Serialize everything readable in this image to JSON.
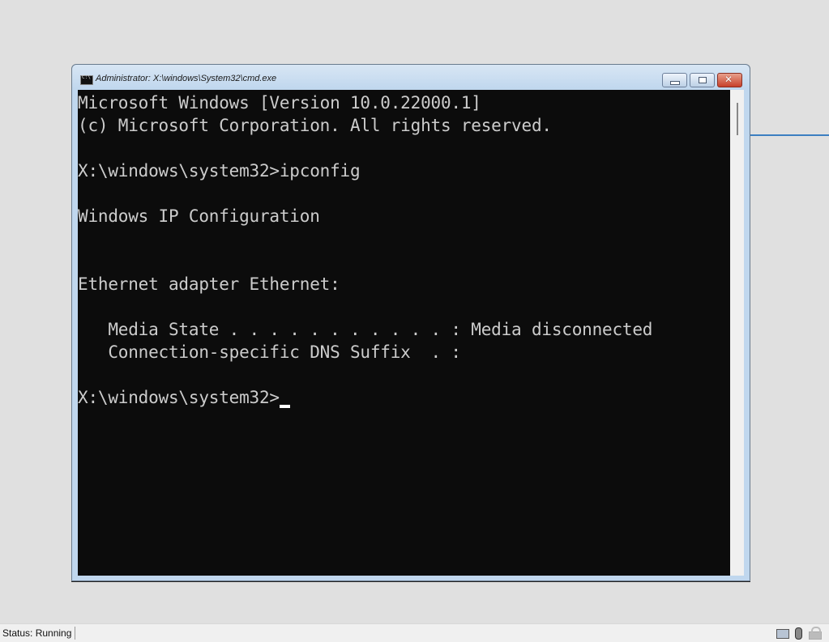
{
  "window": {
    "title": "Administrator: X:\\windows\\System32\\cmd.exe",
    "buttons": {
      "minimize": "minimize",
      "maximize": "maximize",
      "close": "close"
    }
  },
  "console": {
    "lines": [
      "Microsoft Windows [Version 10.0.22000.1]",
      "(c) Microsoft Corporation. All rights reserved.",
      "",
      "X:\\windows\\system32>ipconfig",
      "",
      "Windows IP Configuration",
      "",
      "",
      "Ethernet adapter Ethernet:",
      "",
      "   Media State . . . . . . . . . . . : Media disconnected",
      "   Connection-specific DNS Suffix  . :",
      ""
    ],
    "prompt": "X:\\windows\\system32>"
  },
  "statusbar": {
    "status": "Status: Running",
    "icons": [
      "keyboard-icon",
      "mouse-icon",
      "lock-icon"
    ]
  }
}
